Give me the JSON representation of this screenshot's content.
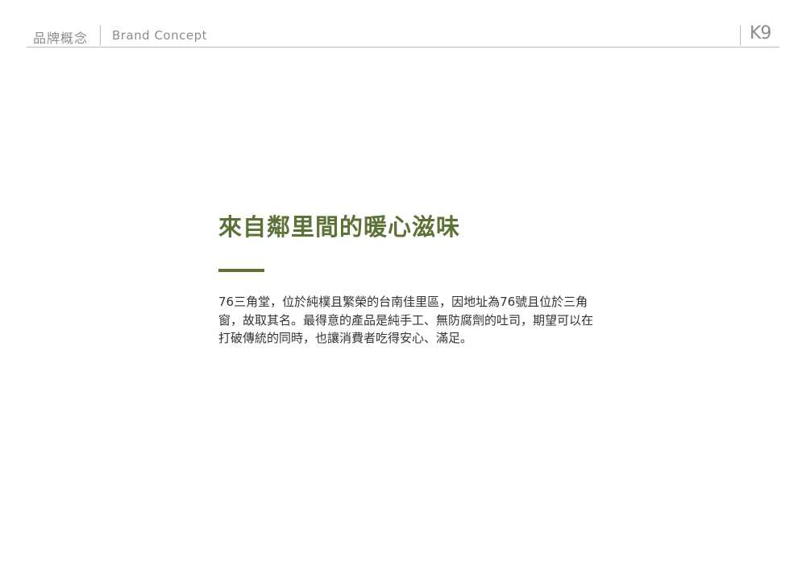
{
  "header": {
    "section_cn": "品牌概念",
    "section_en": "Brand Concept",
    "logo_text": "K9"
  },
  "main": {
    "title": "來自鄰里間的暖心滋味",
    "body": "76三角堂，位於純樸且繁榮的台南佳里區，因地址為76號且位於三角窗，故取其名。最得意的產品是純手工、無防腐劑的吐司，期望可以在打破傳統的同時，也讓消費者吃得安心、滿足。"
  },
  "colors": {
    "accent": "#5d7236",
    "header_text": "#8c8c8c",
    "body_text": "#333333",
    "rule": "#bdbdbd"
  }
}
